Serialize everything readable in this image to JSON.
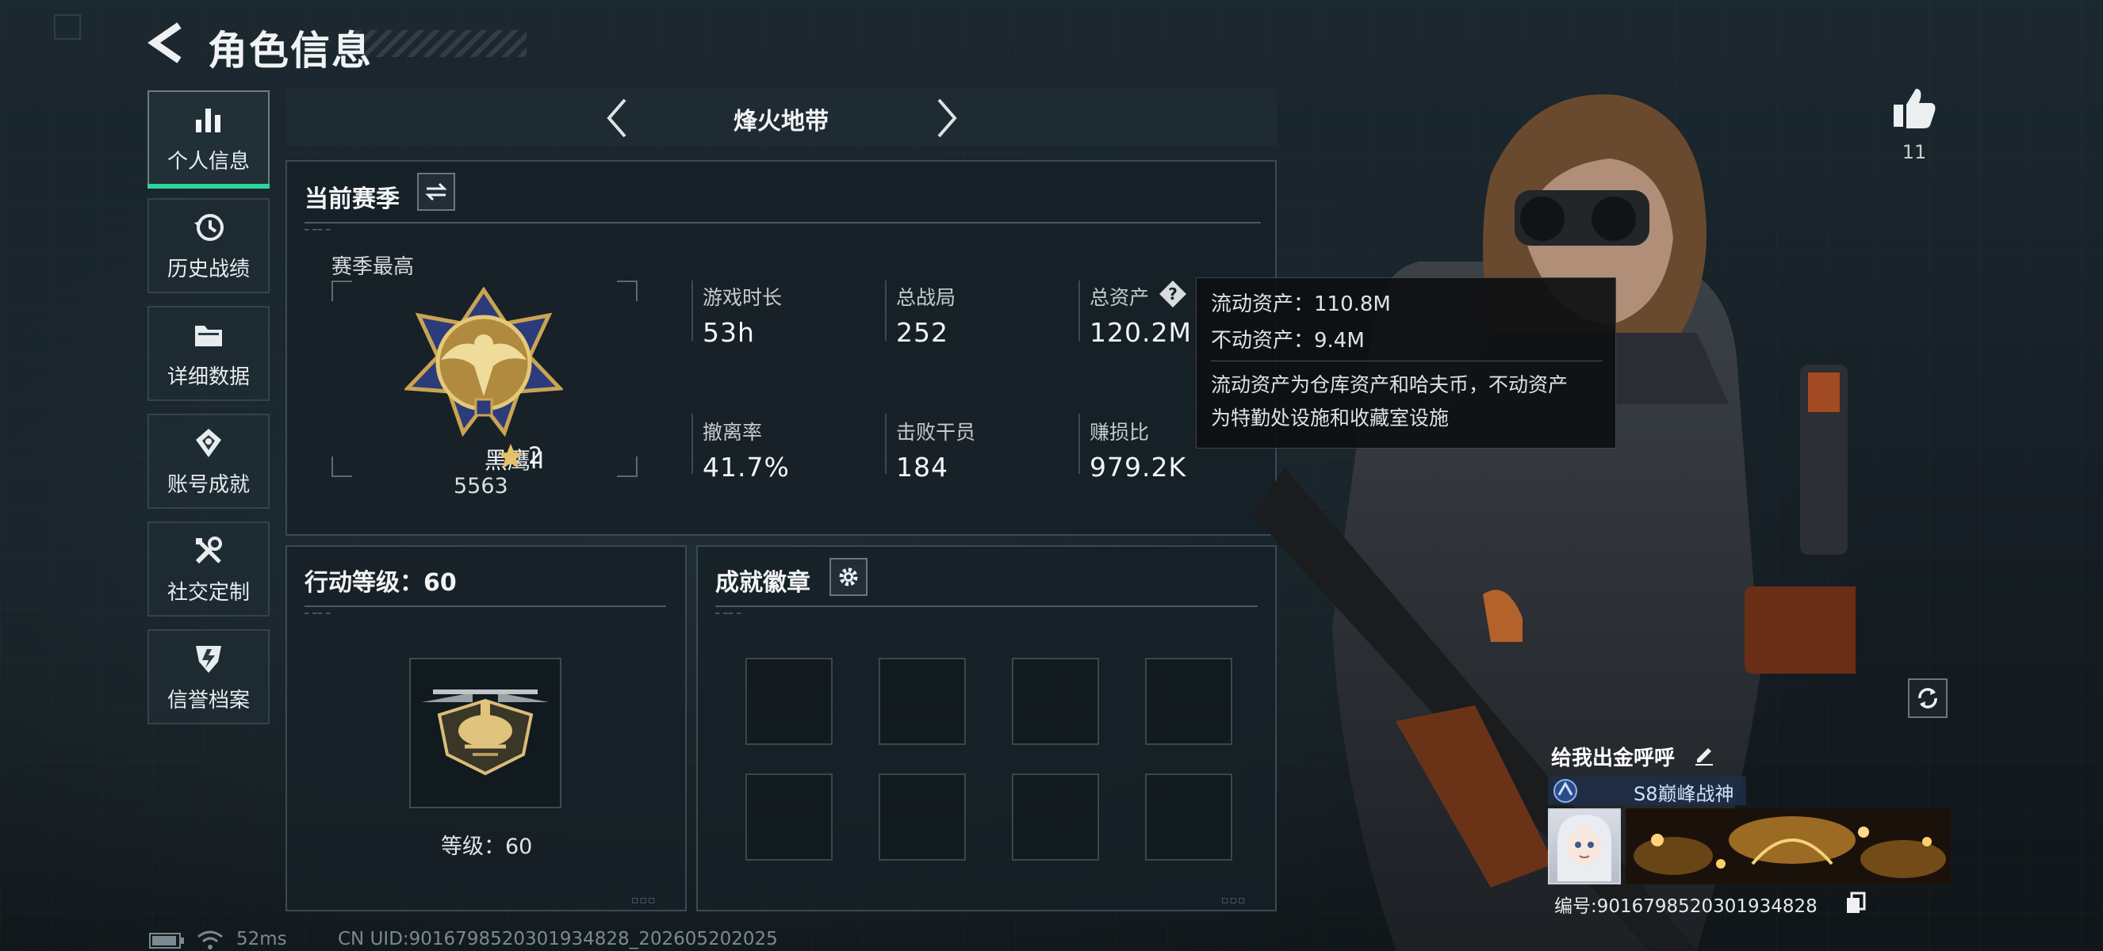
{
  "header": {
    "title": "角色信息"
  },
  "sidebar": {
    "items": [
      {
        "label": "个人信息",
        "icon": "bar-chart-icon",
        "active": true
      },
      {
        "label": "历史战绩",
        "icon": "history-clock-icon",
        "active": false
      },
      {
        "label": "详细数据",
        "icon": "folder-icon",
        "active": false
      },
      {
        "label": "账号成就",
        "icon": "achievement-icon",
        "active": false
      },
      {
        "label": "社交定制",
        "icon": "tools-icon",
        "active": false
      },
      {
        "label": "信誉档案",
        "icon": "shield-credit-icon",
        "active": false
      }
    ]
  },
  "mode": {
    "title": "烽火地带"
  },
  "season": {
    "title": "当前赛季",
    "peak_label": "赛季最高",
    "rank_name": "黑鹰II",
    "rank_stars": "2",
    "rank_score": "5563",
    "stats": [
      {
        "label": "游戏时长",
        "value": "53h"
      },
      {
        "label": "总战局",
        "value": "252"
      },
      {
        "label": "总资产",
        "value": "120.2M"
      },
      {
        "label": "撤离率",
        "value": "41.7%"
      },
      {
        "label": "击败干员",
        "value": "184"
      },
      {
        "label": "赚损比",
        "value": "979.2K"
      }
    ]
  },
  "tooltip": {
    "liquid": "流动资产：110.8M",
    "fixed": "不动资产：9.4M",
    "desc_line1": "流动资产为仓库资产和哈夫币，不动资产",
    "desc_line2": "为特勤处设施和收藏室设施"
  },
  "action_level": {
    "title": "行动等级：60",
    "level_text": "等级：60"
  },
  "badges": {
    "title": "成就徽章",
    "slots": 8
  },
  "likes": {
    "count": "11"
  },
  "profile": {
    "name": "给我出金呼呼",
    "title_badge": "S8巅峰战神",
    "id_text": "编号:9016798520301934828"
  },
  "status_bar": {
    "ping": "52ms",
    "uid": "CN UID:9016798520301934828_202605202025"
  },
  "colors": {
    "accent": "#2fd49a",
    "panel_border": "#3a4a52",
    "text": "#e4e8ea"
  }
}
